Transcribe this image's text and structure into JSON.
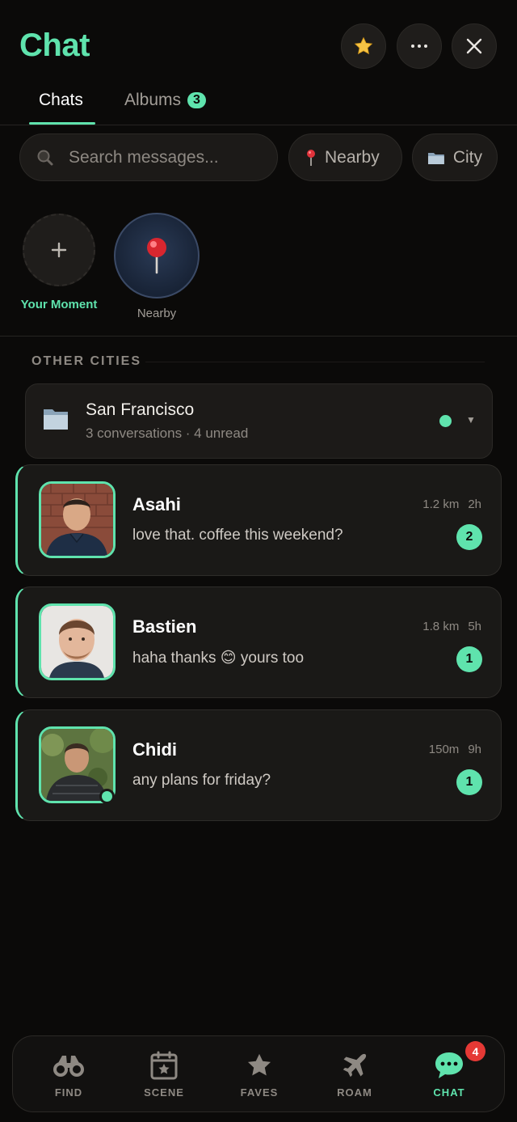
{
  "app": {
    "title": "Chat"
  },
  "header": {
    "icons": [
      "star-icon",
      "more-icon",
      "close-icon"
    ]
  },
  "tabs": [
    {
      "label": "Chats",
      "active": true
    },
    {
      "label": "Albums",
      "badge": "3",
      "active": false
    }
  ],
  "search": {
    "placeholder": "Search messages..."
  },
  "filters": [
    {
      "label": "Nearby",
      "icon": "pin-icon"
    },
    {
      "label": "City",
      "icon": "folder-icon"
    }
  ],
  "moments": [
    {
      "label": "Your Moment",
      "icon": "plus-icon"
    },
    {
      "label": "Nearby",
      "icon": "pin-icon"
    }
  ],
  "section": {
    "title": "OTHER CITIES"
  },
  "city_group": {
    "name": "San Francisco",
    "subtitle": "3 conversations · 4 unread",
    "icon": "folder-icon"
  },
  "conversations": [
    {
      "name": "Asahi",
      "message": "love that. coffee this weekend?",
      "distance": "1.2 km",
      "time": "2h",
      "unread": "2",
      "online": false
    },
    {
      "name": "Bastien",
      "message": "haha thanks 😊 yours too",
      "distance": "1.8 km",
      "time": "5h",
      "unread": "1",
      "online": false
    },
    {
      "name": "Chidi",
      "message": "any plans for friday?",
      "distance": "150m",
      "time": "9h",
      "unread": "1",
      "online": true
    }
  ],
  "nav": {
    "items": [
      {
        "label": "FIND",
        "icon": "binoculars-icon"
      },
      {
        "label": "SCENE",
        "icon": "calendar-star-icon"
      },
      {
        "label": "FAVES",
        "icon": "star-icon"
      },
      {
        "label": "ROAM",
        "icon": "airplane-icon"
      },
      {
        "label": "CHAT",
        "icon": "chat-bubble-icon",
        "active": true
      }
    ],
    "chat_badge": "4"
  },
  "colors": {
    "accent": "#5fe3ad",
    "background": "#0b0a09",
    "badge": "#e53935"
  }
}
